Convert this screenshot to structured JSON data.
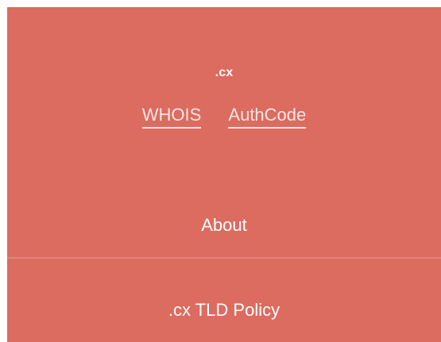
{
  "brand": {
    "title": ".cx"
  },
  "links": {
    "whois": "WHOIS",
    "authcode": "AuthCode"
  },
  "menu": {
    "about": "About",
    "policy": ".cx TLD Policy"
  },
  "colors": {
    "panel": "#dc6b60",
    "text": "#ffffff",
    "link": "#ffe6e2"
  }
}
